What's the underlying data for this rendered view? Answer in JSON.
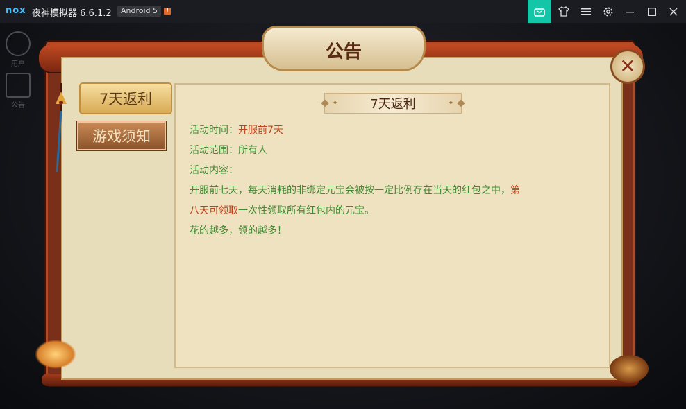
{
  "window": {
    "logo": "nox",
    "title": "夜神模拟器 6.6.1.2",
    "android_badge": "Android 5",
    "warn_badge": "!",
    "buttons": [
      "store-icon",
      "shirt-icon",
      "menu-icon",
      "gear-icon",
      "minimize-icon",
      "maximize-icon",
      "close-icon"
    ],
    "accent_color": "#13c6a8"
  },
  "sidebar": {
    "user_label": "用户",
    "notice_label": "公告"
  },
  "dialog": {
    "title": "公告",
    "close_symbol": "✕",
    "tabs": [
      {
        "label": "7天返利",
        "active": true
      },
      {
        "label": "游戏须知",
        "active": false
      }
    ],
    "content": {
      "heading": "7天返利",
      "time_label": "活动时间：",
      "time_value": "开服前7天",
      "range_label": "活动范围：",
      "range_value": "所有人",
      "content_label": "活动内容：",
      "para1_a": "开服前七天，每天消耗的非绑定元宝会被按一定比例存在当天的红包之中，",
      "para1_b": "第",
      "para2_a": "八天可领取",
      "para2_b": "一次性领取所有红包内的元宝。",
      "para3": "花的越多，领的越多！"
    },
    "colors": {
      "text_green": "#3f8a32",
      "text_red": "#c0411c"
    }
  }
}
